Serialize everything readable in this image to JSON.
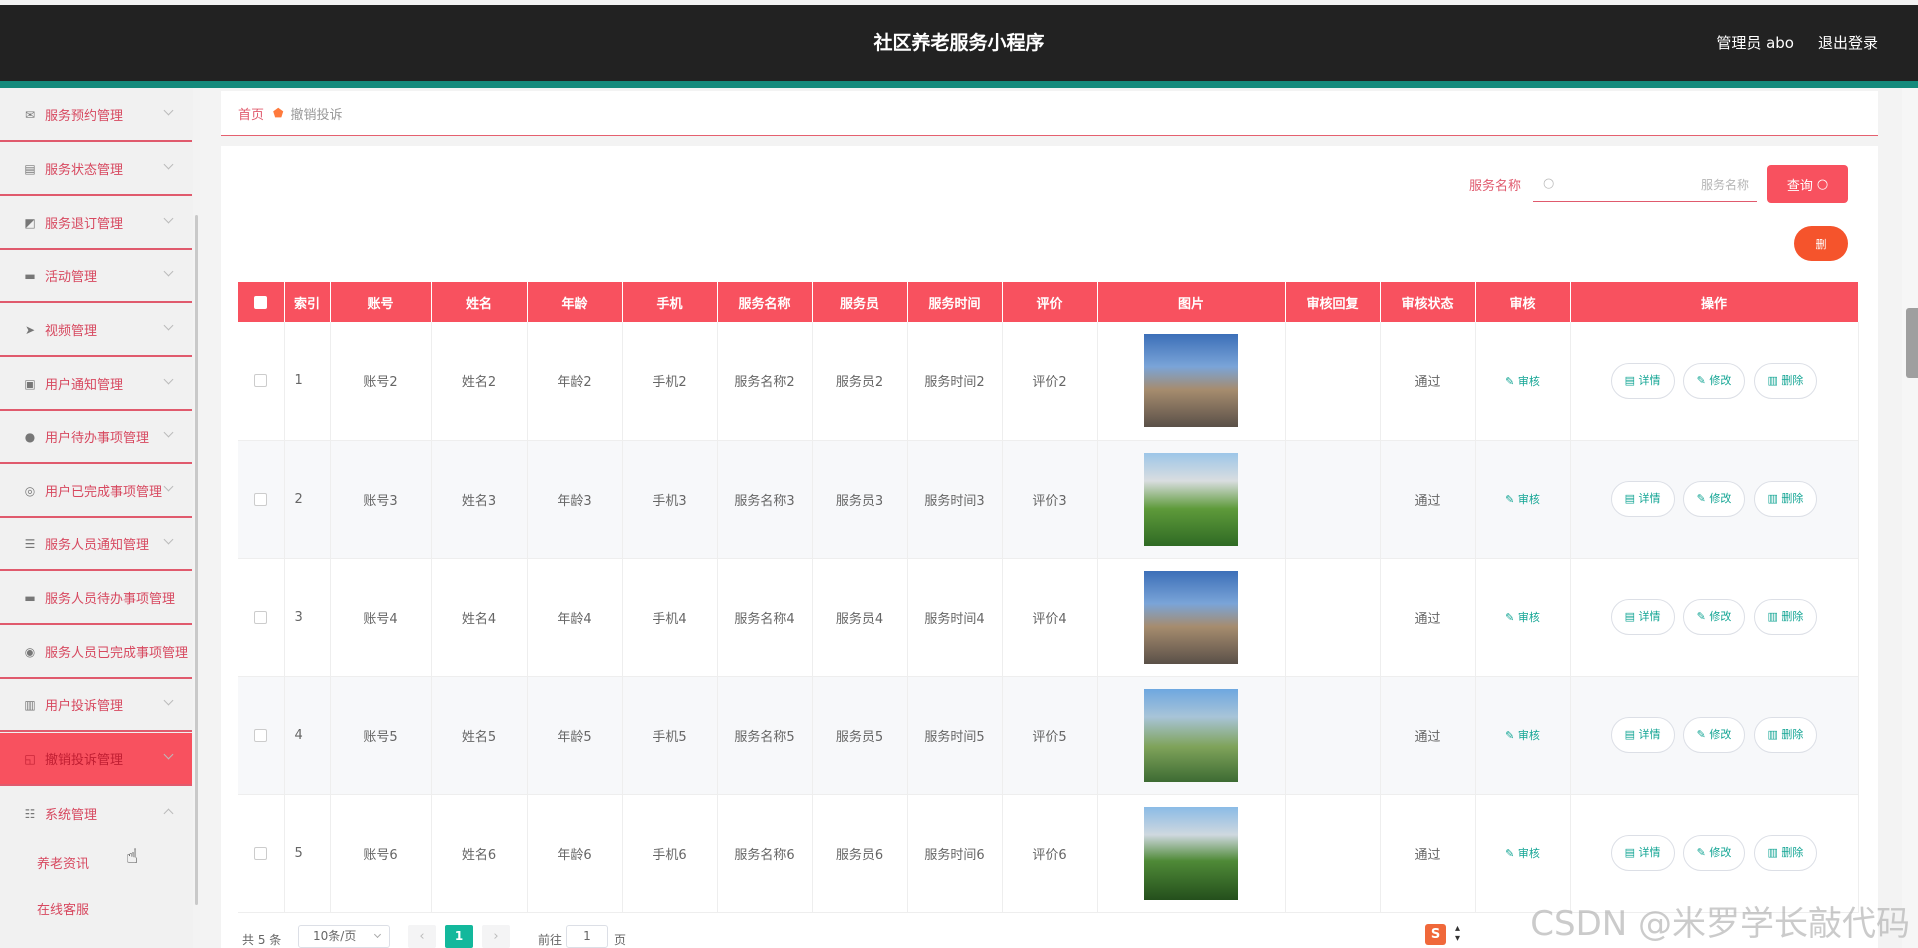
{
  "header": {
    "title": "社区养老服务小程序",
    "admin": "管理员 abo",
    "logout": "退出登录"
  },
  "sidebar": {
    "items": [
      {
        "label": "服务预约管理",
        "icon": "envelope-icon",
        "glyph": "✉"
      },
      {
        "label": "服务状态管理",
        "icon": "clipboard-icon",
        "glyph": "▤"
      },
      {
        "label": "服务退订管理",
        "icon": "chart-icon",
        "glyph": "◩"
      },
      {
        "label": "活动管理",
        "icon": "monitor-icon",
        "glyph": "▬"
      },
      {
        "label": "视频管理",
        "icon": "send-icon",
        "glyph": "➤"
      },
      {
        "label": "用户通知管理",
        "icon": "document-icon",
        "glyph": "▣"
      },
      {
        "label": "用户待办事项管理",
        "icon": "user-icon",
        "glyph": "●"
      },
      {
        "label": "用户已完成事项管理",
        "icon": "compass-icon",
        "glyph": "◎"
      },
      {
        "label": "服务人员通知管理",
        "icon": "list-icon",
        "glyph": "☰"
      },
      {
        "label": "服务人员待办事项管理",
        "icon": "message-icon",
        "glyph": "▬"
      },
      {
        "label": "服务人员已完成事项管理",
        "icon": "location-icon",
        "glyph": "◉"
      },
      {
        "label": "用户投诉管理",
        "icon": "bar-icon",
        "glyph": "▥"
      },
      {
        "label": "撤销投诉管理",
        "icon": "crop-icon",
        "glyph": "◱"
      },
      {
        "label": "系统管理",
        "icon": "sliders-icon",
        "glyph": "☷"
      }
    ],
    "subitems": [
      "养老资讯",
      "在线客服"
    ]
  },
  "breadcrumb": {
    "home": "首页",
    "current": "撤销投诉"
  },
  "search": {
    "label": "服务名称",
    "placeholder": "服务名称",
    "query_button": "查询"
  },
  "delete_button": "删",
  "table": {
    "headers": [
      "索引",
      "账号",
      "姓名",
      "年龄",
      "手机",
      "服务名称",
      "服务员",
      "服务时间",
      "评价",
      "图片",
      "审核回复",
      "审核状态",
      "审核",
      "操作"
    ],
    "rows": [
      {
        "index": "1",
        "account": "账号2",
        "name": "姓名2",
        "age": "年龄2",
        "phone": "手机2",
        "service": "服务名称2",
        "staff": "服务员2",
        "time": "服务时间2",
        "review": "评价2",
        "reply": "",
        "status": "通过"
      },
      {
        "index": "2",
        "account": "账号3",
        "name": "姓名3",
        "age": "年龄3",
        "phone": "手机3",
        "service": "服务名称3",
        "staff": "服务员3",
        "time": "服务时间3",
        "review": "评价3",
        "reply": "",
        "status": "通过"
      },
      {
        "index": "3",
        "account": "账号4",
        "name": "姓名4",
        "age": "年龄4",
        "phone": "手机4",
        "service": "服务名称4",
        "staff": "服务员4",
        "time": "服务时间4",
        "review": "评价4",
        "reply": "",
        "status": "通过"
      },
      {
        "index": "4",
        "account": "账号5",
        "name": "姓名5",
        "age": "年龄5",
        "phone": "手机5",
        "service": "服务名称5",
        "staff": "服务员5",
        "time": "服务时间5",
        "review": "评价5",
        "reply": "",
        "status": "通过"
      },
      {
        "index": "5",
        "account": "账号6",
        "name": "姓名6",
        "age": "年龄6",
        "phone": "手机6",
        "service": "服务名称6",
        "staff": "服务员6",
        "time": "服务时间6",
        "review": "评价6",
        "reply": "",
        "status": "通过"
      }
    ],
    "actions": {
      "audit": "审核",
      "detail": "详情",
      "edit": "修改",
      "delete": "删除"
    }
  },
  "pagination": {
    "total": "共 5 条",
    "page_size": "10条/页",
    "current_page": "1",
    "goto_label": "前往",
    "goto_value": "1",
    "page_suffix": "页"
  },
  "watermark": "CSDN @米罗学长敲代码",
  "colors": {
    "header_bg": "#222222",
    "accent_teal": "#148a7c",
    "primary_red": "#f8515f",
    "link_teal": "#13a594",
    "delete_orange": "#f5542c"
  }
}
